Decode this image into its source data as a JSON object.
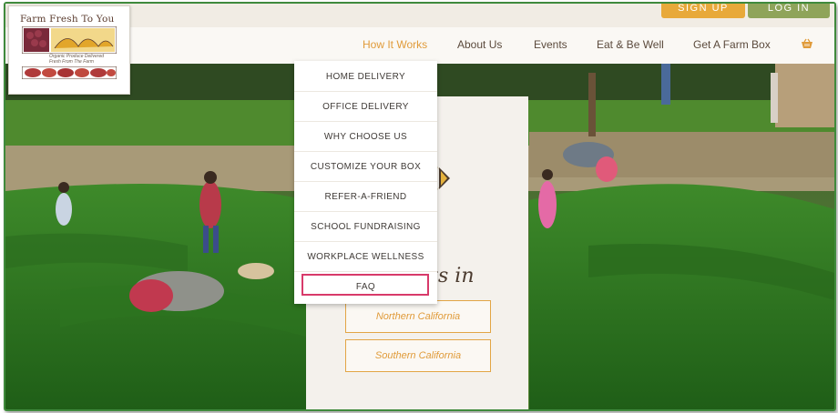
{
  "header": {
    "signup_label": "SIGN UP",
    "login_label": "LOG IN"
  },
  "logo": {
    "title": "Farm Fresh To You",
    "tagline_1": "Organic Produce Delivered",
    "tagline_2": "Fresh From The Farm"
  },
  "nav": {
    "items": [
      {
        "label": "How It Works",
        "active": true
      },
      {
        "label": "About Us"
      },
      {
        "label": "Events"
      },
      {
        "label": "Eat & Be Well"
      },
      {
        "label": "Get A Farm Box"
      }
    ],
    "cart_icon": "basket-icon"
  },
  "dropdown": {
    "items": [
      {
        "label": "HOME DELIVERY"
      },
      {
        "label": "OFFICE DELIVERY"
      },
      {
        "label": "WHY CHOOSE US"
      },
      {
        "label": "CUSTOMIZE YOUR BOX"
      },
      {
        "label": "REFER-A-FRIEND"
      },
      {
        "label": "SCHOOL FUNDRAISING"
      },
      {
        "label": "WORKPLACE WELLNESS"
      },
      {
        "label": "FAQ",
        "highlighted": true
      }
    ]
  },
  "hero": {
    "heading_fragment": "nts in",
    "regions": [
      {
        "label": "Northern California"
      },
      {
        "label": "Southern California"
      }
    ]
  },
  "colors": {
    "accent": "#e09b3a",
    "signup": "#e8a93a",
    "login": "#8fa45a",
    "highlight": "#d83a6a",
    "frame": "#3f8a3c"
  }
}
